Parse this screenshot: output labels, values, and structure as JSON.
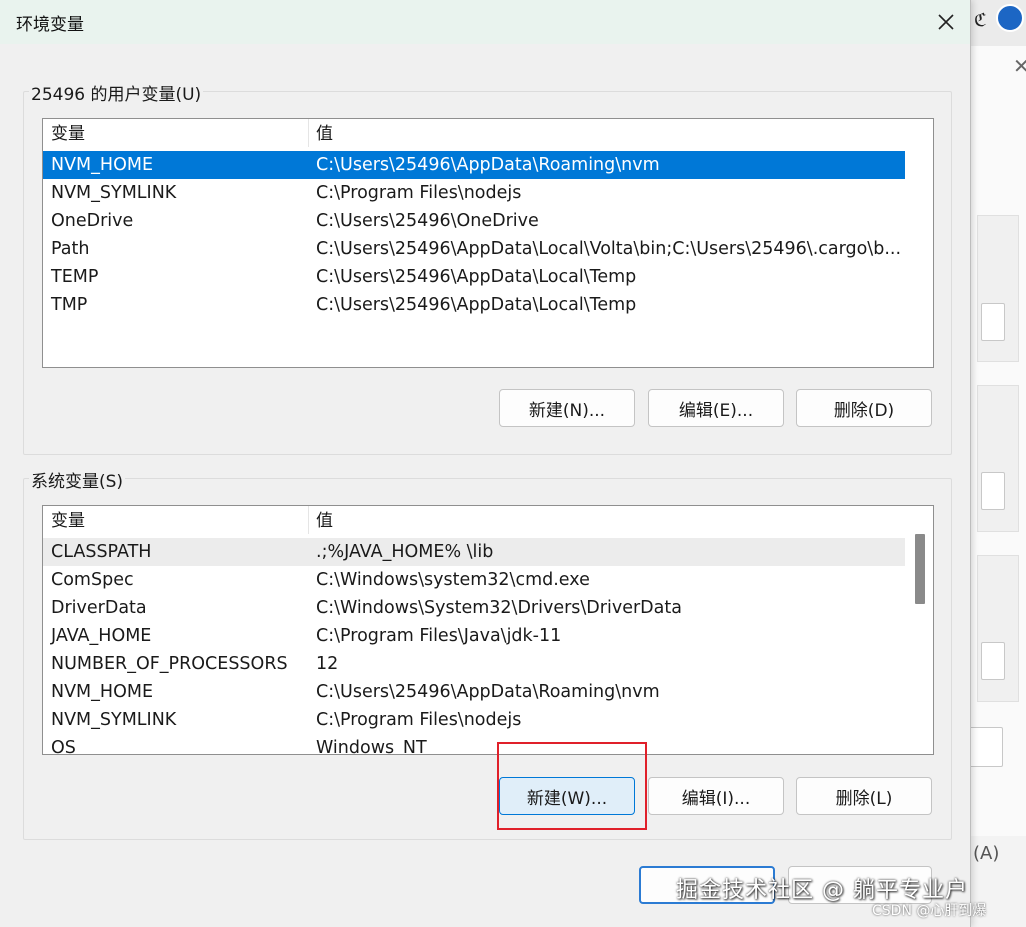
{
  "dialog": {
    "title": "环境变量",
    "user_group_label": "25496 的用户变量(U)",
    "system_group_label": "系统变量(S)",
    "columns": {
      "name": "变量",
      "value": "值"
    },
    "user_vars": [
      {
        "name": "NVM_HOME",
        "value": "C:\\Users\\25496\\AppData\\Roaming\\nvm",
        "selected": true
      },
      {
        "name": "NVM_SYMLINK",
        "value": "C:\\Program Files\\nodejs"
      },
      {
        "name": "OneDrive",
        "value": "C:\\Users\\25496\\OneDrive"
      },
      {
        "name": "Path",
        "value": "C:\\Users\\25496\\AppData\\Local\\Volta\\bin;C:\\Users\\25496\\.cargo\\b..."
      },
      {
        "name": "TEMP",
        "value": "C:\\Users\\25496\\AppData\\Local\\Temp"
      },
      {
        "name": "TMP",
        "value": "C:\\Users\\25496\\AppData\\Local\\Temp"
      }
    ],
    "system_vars": [
      {
        "name": "CLASSPATH",
        "value": ".;%JAVA_HOME% \\lib"
      },
      {
        "name": "ComSpec",
        "value": "C:\\Windows\\system32\\cmd.exe"
      },
      {
        "name": "DriverData",
        "value": "C:\\Windows\\System32\\Drivers\\DriverData"
      },
      {
        "name": "JAVA_HOME",
        "value": "C:\\Program Files\\Java\\jdk-11"
      },
      {
        "name": "NUMBER_OF_PROCESSORS",
        "value": "12"
      },
      {
        "name": "NVM_HOME",
        "value": "C:\\Users\\25496\\AppData\\Roaming\\nvm"
      },
      {
        "name": "NVM_SYMLINK",
        "value": "C:\\Program Files\\nodejs"
      },
      {
        "name": "OS",
        "value": "Windows_NT"
      }
    ],
    "user_buttons": {
      "new": "新建(N)...",
      "edit": "编辑(E)...",
      "delete": "删除(D)"
    },
    "system_buttons": {
      "new": "新建(W)...",
      "edit": "编辑(I)...",
      "delete": "删除(L)"
    },
    "footer_buttons": {
      "ok": "",
      "cancel": ""
    }
  },
  "background_window": {
    "partial_label": "(A)"
  },
  "watermarks": {
    "line1": "掘金技术社区 @ 躺平专业户",
    "line2": "CSDN @心肝到爆"
  },
  "colors": {
    "selection": "#0078d7",
    "highlight_box": "#e0202a",
    "focus_border": "#0078d7"
  },
  "icons": {
    "close": "close-icon"
  }
}
